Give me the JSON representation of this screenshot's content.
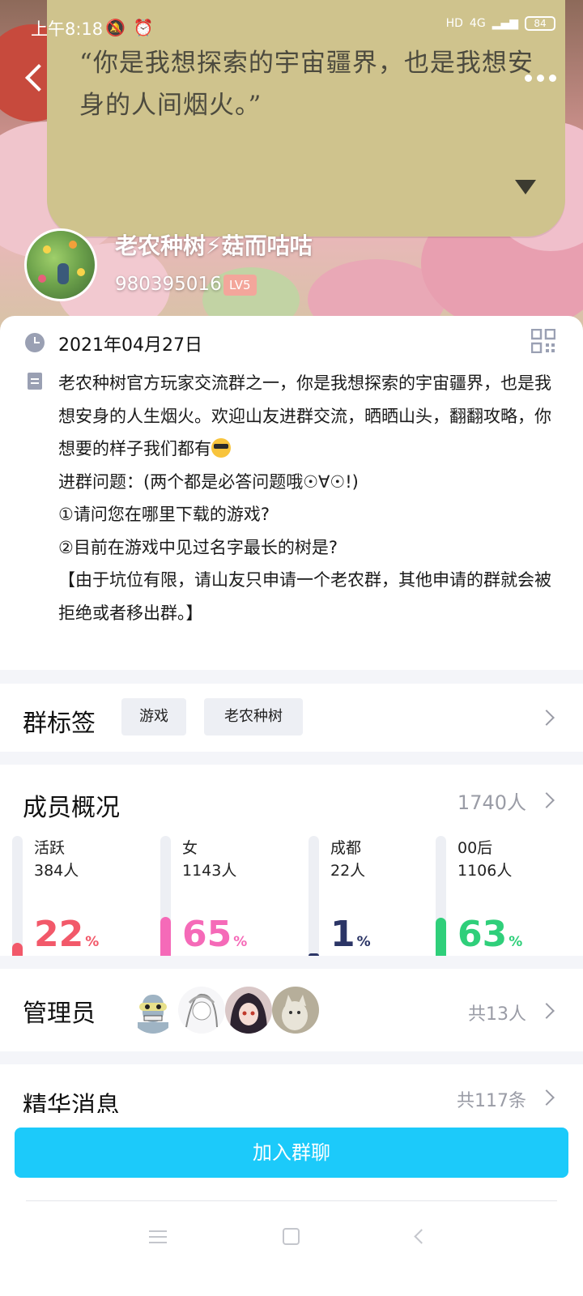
{
  "status_bar": {
    "time": "上午8:18",
    "icons": [
      "mute-icon",
      "alarm-icon",
      "cloud-icon",
      "app-icon"
    ],
    "hd": "HD",
    "network": "4G",
    "battery": "84"
  },
  "header": {
    "quote": "“你是我想探索的宇宙疆界，也是我想安身的人间烟火。”",
    "group_name": "老农种树⚡菇而咕咕",
    "group_id": "980395016",
    "level": "LV5"
  },
  "info": {
    "date": "2021年04月27日",
    "description": [
      "老农种树官方玩家交流群之一，你是我想探索的宇宙疆界，也是我想安身的人生烟火。欢迎山友进群交流，晒晒山头，翻翻攻略，你想要的样子我们都有",
      "进群问题：(两个都是必答问题哦☉∀☉!)",
      "①请问您在哪里下载的游戏?",
      "②目前在游戏中见过名字最长的树是?",
      "【由于坑位有限，请山友只申请一个老农群，其他申请的群就会被拒绝或者移出群。】"
    ]
  },
  "tags": {
    "title": "群标签",
    "items": [
      "游戏",
      "老农种树"
    ]
  },
  "members": {
    "title": "成员概况",
    "total": "1740人",
    "stats": [
      {
        "label": "活跃",
        "count": "384人",
        "percent": "22",
        "unit": "%",
        "color": "#f2596a"
      },
      {
        "label": "女",
        "count": "1143人",
        "percent": "65",
        "unit": "%",
        "color": "#f56ab8"
      },
      {
        "label": "成都",
        "count": "22人",
        "percent": "1",
        "unit": "%",
        "color": "#2b3566"
      },
      {
        "label": "00后",
        "count": "1106人",
        "percent": "63",
        "unit": "%",
        "color": "#2fcf7a"
      }
    ]
  },
  "admins": {
    "title": "管理员",
    "count": "共13人",
    "avatars": [
      "bender-avatar",
      "sketch-girl-avatar",
      "anime-girl-avatar",
      "cat-avatar"
    ]
  },
  "essence": {
    "title": "精华消息",
    "count": "共117条"
  },
  "join_button": "加入群聊",
  "nav": {
    "menu": "menu-icon",
    "home": "home-icon",
    "back": "back-icon"
  }
}
